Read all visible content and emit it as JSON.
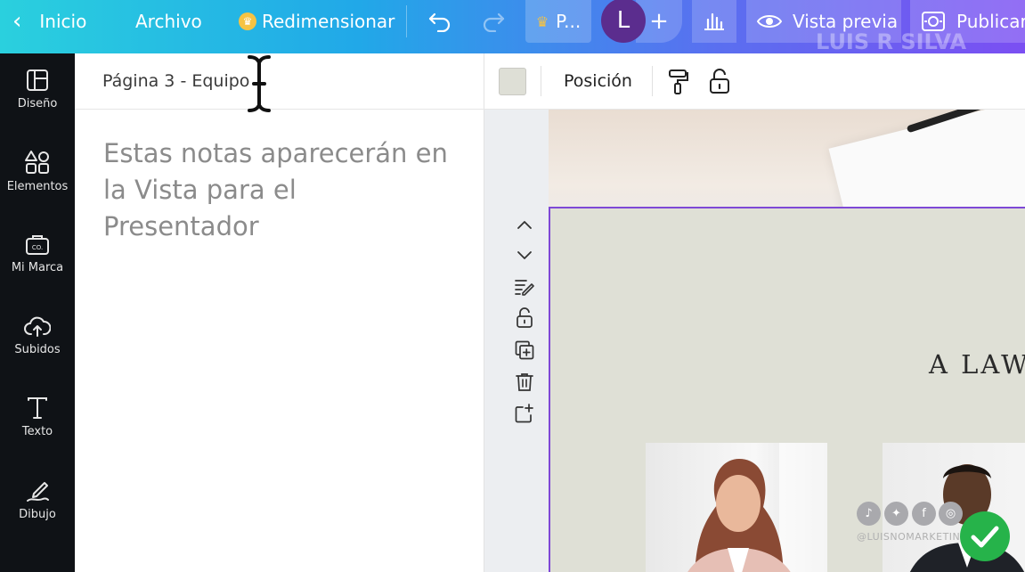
{
  "topbar": {
    "home_label": "Inicio",
    "file_label": "Archivo",
    "resize_label": "Redimensionar",
    "pro_label": "P...",
    "avatar_initial": "L",
    "preview_label": "Vista previa",
    "publish_label": "Publicar",
    "watermark": "LUIS R SILVA"
  },
  "sidebar": {
    "items": [
      {
        "label": "Diseño",
        "icon": "layout-icon"
      },
      {
        "label": "Elementos",
        "icon": "shapes-icon"
      },
      {
        "label": "Mi Marca",
        "icon": "brand-kit-icon"
      },
      {
        "label": "Subidos",
        "icon": "cloud-upload-icon"
      },
      {
        "label": "Texto",
        "icon": "text-icon"
      },
      {
        "label": "Dibujo",
        "icon": "draw-icon"
      }
    ]
  },
  "notes": {
    "page_title": "Página 3 - Equipo",
    "placeholder": "Estas notas aparecerán en la Vista para el Presentador"
  },
  "editor": {
    "position_label": "Posición",
    "swatch_color": "#dedfd6",
    "page_heading": "A LAW F",
    "selection_color": "#7e48d6"
  },
  "overlay": {
    "handle": "@LUISNOMARKETING",
    "social_icons": [
      "tiktok-icon",
      "twitter-icon",
      "facebook-icon",
      "instagram-icon"
    ]
  }
}
